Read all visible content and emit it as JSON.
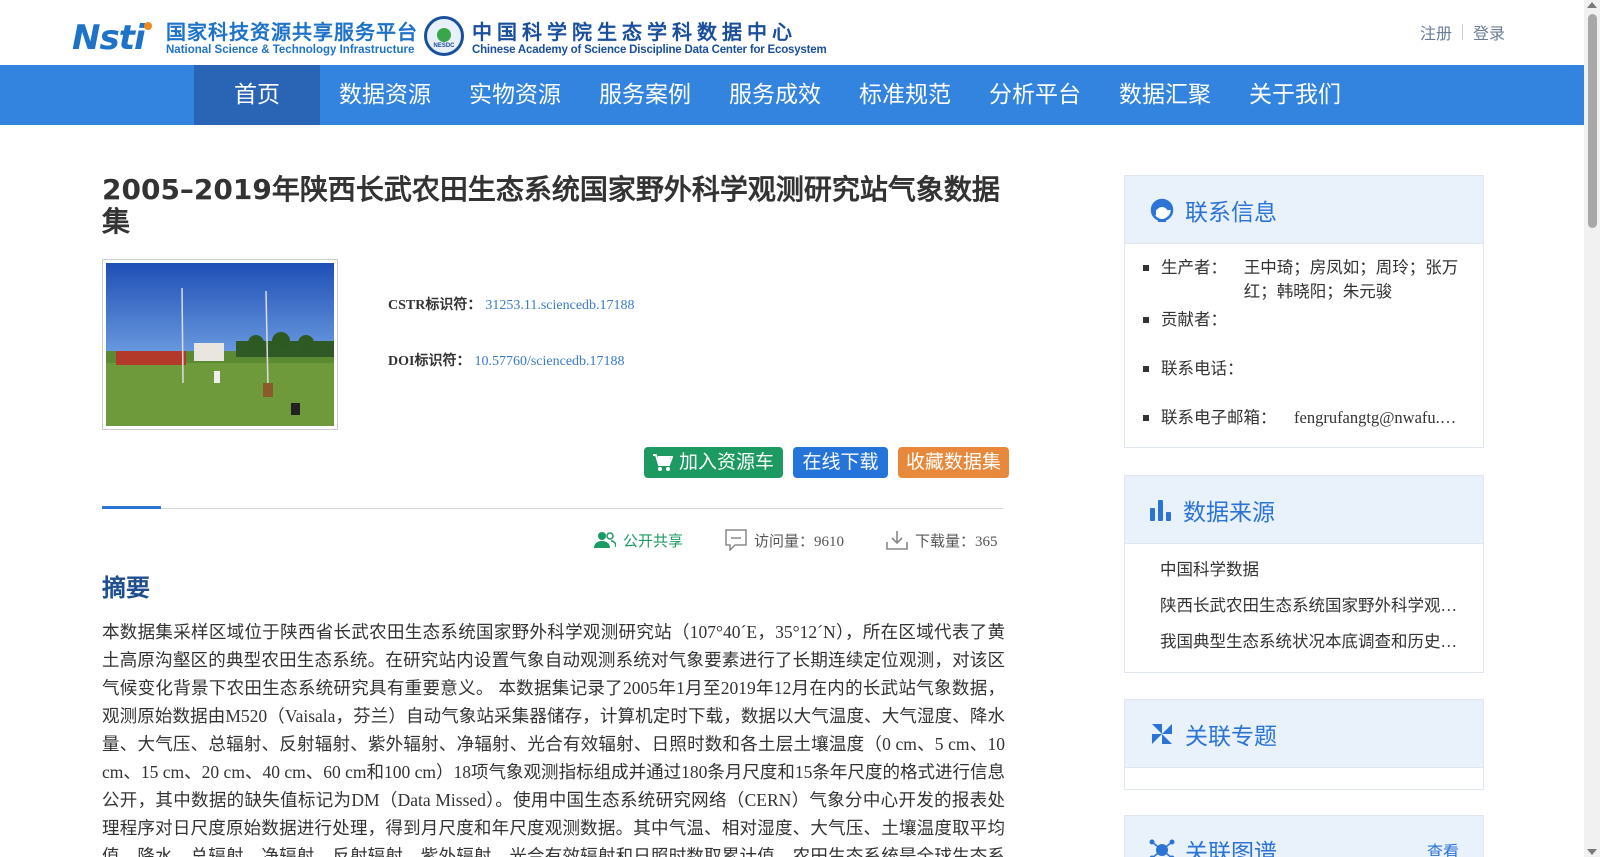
{
  "header": {
    "nsti_logo": {
      "mark": "Nsti",
      "cn": "国家科技资源共享服务平台",
      "en": "National Science & Technology Infrastructure"
    },
    "nesdc_logo": {
      "badge": "NESDC",
      "cn": "中国科学院生态学科数据中心",
      "en": "Chinese Academy of Science Discipline Data Center for Ecosystem"
    },
    "auth": {
      "register": "注册",
      "login": "登录"
    }
  },
  "nav": {
    "items": [
      {
        "label": "首页",
        "active": true
      },
      {
        "label": "数据资源"
      },
      {
        "label": "实物资源"
      },
      {
        "label": "服务案例"
      },
      {
        "label": "服务成效"
      },
      {
        "label": "标准规范"
      },
      {
        "label": "分析平台"
      },
      {
        "label": "数据汇聚"
      },
      {
        "label": "关于我们"
      }
    ]
  },
  "dataset": {
    "title": "2005–2019年陕西长武农田生态系统国家野外科学观测研究站气象数据集",
    "cstr_label": "CSTR标识符：",
    "cstr_value": "31253.11.sciencedb.17188",
    "doi_label": "DOI标识符：",
    "doi_value": "10.57760/sciencedb.17188",
    "buttons": {
      "cart": "加入资源车",
      "download": "在线下载",
      "favorite": "收藏数据集"
    },
    "stats": {
      "share": "公开共享",
      "visits": "访问量：9610",
      "downloads": "下载量：365"
    },
    "abstract_heading": "摘要",
    "abstract": "本数据集采样区域位于陕西省长武农田生态系统国家野外科学观测研究站（107°40´E，35°12´N），所在区域代表了黄土高原沟壑区的典型农田生态系统。在研究站内设置气象自动观测系统对气象要素进行了长期连续定位观测，对该区气候变化背景下农田生态系统研究具有重要意义。 本数据集记录了2005年1月至2019年12月在内的长武站气象数据，观测原始数据由M520（Vaisala，芬兰）自动气象站采集器储存，计算机定时下载，数据以大气温度、大气湿度、降水量、大气压、总辐射、反射辐射、紫外辐射、净辐射、光合有效辐射、日照时数和各土层土壤温度（0 cm、5 cm、10 cm、15 cm、20 cm、40 cm、60 cm和100 cm）18项气象观测指标组成并通过180条月尺度和15条年尺度的格式进行信息公开，其中数据的缺失值标记为DM（Data Missed）。使用中国生态系统研究网络（CERN）气象分中心开发的报表处理程序对日尺度原始数据进行处理，得到月尺度和年尺度观测数据。其中气温、相对湿度、大气压、土壤温度取平均值，降水、总辐射、净辐射、反射辐射、紫外辐射、光合有效辐射和日照时数取累计值。农田生态系统是全球生态系统的重要组成部分，对"
  },
  "sidebar": {
    "contact": {
      "title": "联系信息",
      "producer_label": "生产者：",
      "producer_value": "王中琦；房凤如；周玲；张万红；韩晓阳；朱元骏",
      "contributor_label": "贡献者：",
      "contributor_value": "",
      "phone_label": "联系电话：",
      "phone_value": "",
      "email_label": "联系电子邮箱：",
      "email_value": "fengrufangtg@nwafu.edu.cn"
    },
    "source": {
      "title": "数据来源",
      "items": [
        "中国科学数据",
        "陕西长武农田生态系统国家野外科学观测研究站",
        "我国典型生态系统状况本底调查和历史数据整编"
      ]
    },
    "topic": {
      "title": "关联专题"
    },
    "graph": {
      "title": "关联图谱",
      "more": "查看"
    }
  },
  "colors": {
    "nav_bg": "#3384de",
    "nav_active": "#2a64b4",
    "accent": "#2b74d6",
    "cart_green": "#1c9a61",
    "download_blue": "#2574d9",
    "fav_orange": "#e8883a"
  }
}
